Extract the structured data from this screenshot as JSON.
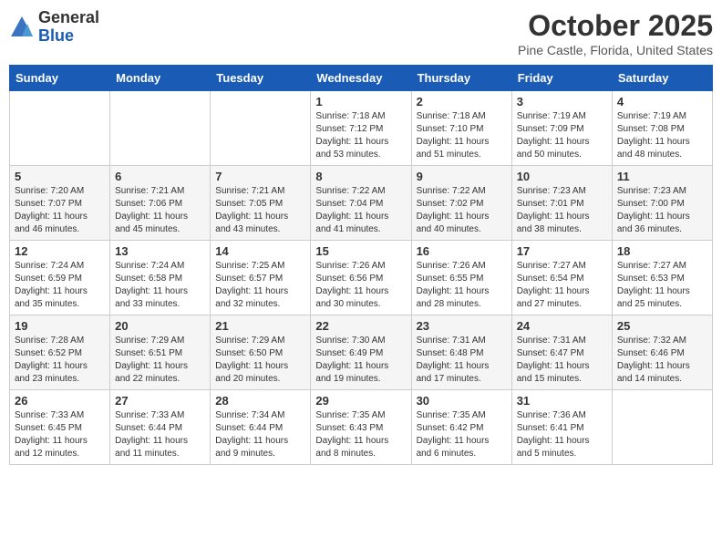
{
  "header": {
    "logo_general": "General",
    "logo_blue": "Blue",
    "title": "October 2025",
    "location": "Pine Castle, Florida, United States"
  },
  "weekdays": [
    "Sunday",
    "Monday",
    "Tuesday",
    "Wednesday",
    "Thursday",
    "Friday",
    "Saturday"
  ],
  "weeks": [
    [
      {
        "day": "",
        "info": ""
      },
      {
        "day": "",
        "info": ""
      },
      {
        "day": "",
        "info": ""
      },
      {
        "day": "1",
        "info": "Sunrise: 7:18 AM\nSunset: 7:12 PM\nDaylight: 11 hours and 53 minutes."
      },
      {
        "day": "2",
        "info": "Sunrise: 7:18 AM\nSunset: 7:10 PM\nDaylight: 11 hours and 51 minutes."
      },
      {
        "day": "3",
        "info": "Sunrise: 7:19 AM\nSunset: 7:09 PM\nDaylight: 11 hours and 50 minutes."
      },
      {
        "day": "4",
        "info": "Sunrise: 7:19 AM\nSunset: 7:08 PM\nDaylight: 11 hours and 48 minutes."
      }
    ],
    [
      {
        "day": "5",
        "info": "Sunrise: 7:20 AM\nSunset: 7:07 PM\nDaylight: 11 hours and 46 minutes."
      },
      {
        "day": "6",
        "info": "Sunrise: 7:21 AM\nSunset: 7:06 PM\nDaylight: 11 hours and 45 minutes."
      },
      {
        "day": "7",
        "info": "Sunrise: 7:21 AM\nSunset: 7:05 PM\nDaylight: 11 hours and 43 minutes."
      },
      {
        "day": "8",
        "info": "Sunrise: 7:22 AM\nSunset: 7:04 PM\nDaylight: 11 hours and 41 minutes."
      },
      {
        "day": "9",
        "info": "Sunrise: 7:22 AM\nSunset: 7:02 PM\nDaylight: 11 hours and 40 minutes."
      },
      {
        "day": "10",
        "info": "Sunrise: 7:23 AM\nSunset: 7:01 PM\nDaylight: 11 hours and 38 minutes."
      },
      {
        "day": "11",
        "info": "Sunrise: 7:23 AM\nSunset: 7:00 PM\nDaylight: 11 hours and 36 minutes."
      }
    ],
    [
      {
        "day": "12",
        "info": "Sunrise: 7:24 AM\nSunset: 6:59 PM\nDaylight: 11 hours and 35 minutes."
      },
      {
        "day": "13",
        "info": "Sunrise: 7:24 AM\nSunset: 6:58 PM\nDaylight: 11 hours and 33 minutes."
      },
      {
        "day": "14",
        "info": "Sunrise: 7:25 AM\nSunset: 6:57 PM\nDaylight: 11 hours and 32 minutes."
      },
      {
        "day": "15",
        "info": "Sunrise: 7:26 AM\nSunset: 6:56 PM\nDaylight: 11 hours and 30 minutes."
      },
      {
        "day": "16",
        "info": "Sunrise: 7:26 AM\nSunset: 6:55 PM\nDaylight: 11 hours and 28 minutes."
      },
      {
        "day": "17",
        "info": "Sunrise: 7:27 AM\nSunset: 6:54 PM\nDaylight: 11 hours and 27 minutes."
      },
      {
        "day": "18",
        "info": "Sunrise: 7:27 AM\nSunset: 6:53 PM\nDaylight: 11 hours and 25 minutes."
      }
    ],
    [
      {
        "day": "19",
        "info": "Sunrise: 7:28 AM\nSunset: 6:52 PM\nDaylight: 11 hours and 23 minutes."
      },
      {
        "day": "20",
        "info": "Sunrise: 7:29 AM\nSunset: 6:51 PM\nDaylight: 11 hours and 22 minutes."
      },
      {
        "day": "21",
        "info": "Sunrise: 7:29 AM\nSunset: 6:50 PM\nDaylight: 11 hours and 20 minutes."
      },
      {
        "day": "22",
        "info": "Sunrise: 7:30 AM\nSunset: 6:49 PM\nDaylight: 11 hours and 19 minutes."
      },
      {
        "day": "23",
        "info": "Sunrise: 7:31 AM\nSunset: 6:48 PM\nDaylight: 11 hours and 17 minutes."
      },
      {
        "day": "24",
        "info": "Sunrise: 7:31 AM\nSunset: 6:47 PM\nDaylight: 11 hours and 15 minutes."
      },
      {
        "day": "25",
        "info": "Sunrise: 7:32 AM\nSunset: 6:46 PM\nDaylight: 11 hours and 14 minutes."
      }
    ],
    [
      {
        "day": "26",
        "info": "Sunrise: 7:33 AM\nSunset: 6:45 PM\nDaylight: 11 hours and 12 minutes."
      },
      {
        "day": "27",
        "info": "Sunrise: 7:33 AM\nSunset: 6:44 PM\nDaylight: 11 hours and 11 minutes."
      },
      {
        "day": "28",
        "info": "Sunrise: 7:34 AM\nSunset: 6:44 PM\nDaylight: 11 hours and 9 minutes."
      },
      {
        "day": "29",
        "info": "Sunrise: 7:35 AM\nSunset: 6:43 PM\nDaylight: 11 hours and 8 minutes."
      },
      {
        "day": "30",
        "info": "Sunrise: 7:35 AM\nSunset: 6:42 PM\nDaylight: 11 hours and 6 minutes."
      },
      {
        "day": "31",
        "info": "Sunrise: 7:36 AM\nSunset: 6:41 PM\nDaylight: 11 hours and 5 minutes."
      },
      {
        "day": "",
        "info": ""
      }
    ]
  ]
}
